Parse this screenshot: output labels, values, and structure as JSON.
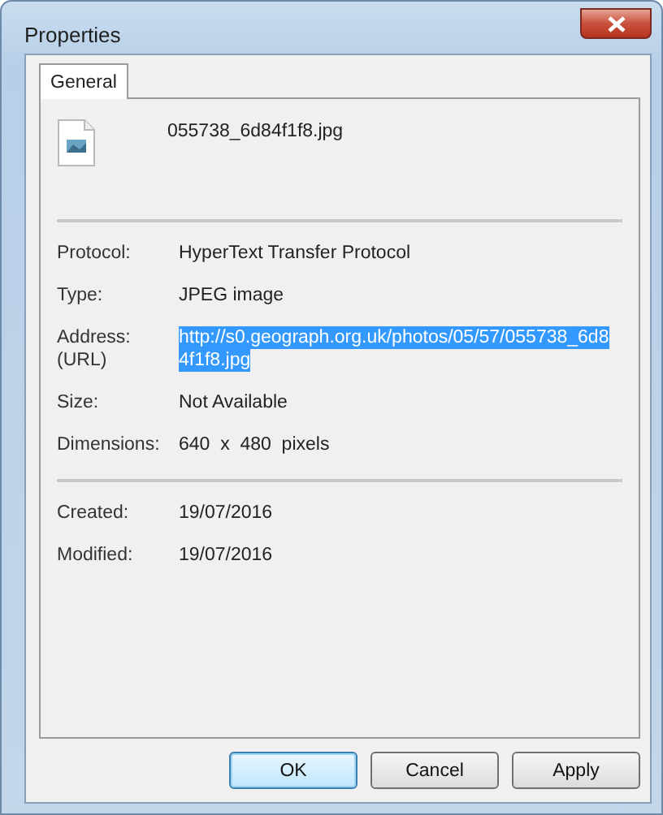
{
  "window": {
    "title": "Properties"
  },
  "tabs": [
    {
      "label": "General",
      "selected": true
    }
  ],
  "file": {
    "name": "055738_6d84f1f8.jpg"
  },
  "sections": [
    {
      "rows": [
        {
          "label": "Protocol:",
          "value": [
            "HyperText Transfer Protocol"
          ],
          "selected": false
        },
        {
          "label": "Type:",
          "value": [
            "JPEG image"
          ],
          "selected": false
        },
        {
          "label": "Address:\n(URL)",
          "value": [
            "http://s0.geograph.org.uk/photos/05/57/055738_6d8",
            "4f1f8.jpg"
          ],
          "selected": true
        },
        {
          "label": "Size:",
          "value": [
            "Not Available"
          ],
          "selected": false
        },
        {
          "label": "Dimensions:",
          "value": [
            "640  x  480  pixels"
          ],
          "selected": false
        }
      ]
    },
    {
      "rows": [
        {
          "label": "Created:",
          "value": [
            "19/07/2016"
          ],
          "selected": false
        },
        {
          "label": "Modified:",
          "value": [
            "19/07/2016"
          ],
          "selected": false
        }
      ]
    }
  ],
  "buttons": [
    {
      "label": "OK",
      "default": true
    },
    {
      "label": "Cancel",
      "default": false
    },
    {
      "label": "Apply",
      "default": false
    }
  ]
}
